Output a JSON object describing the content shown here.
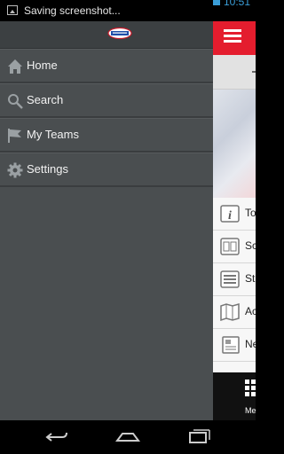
{
  "status_bar": {
    "notification_text": "Saving screenshot...",
    "clock": "10:51"
  },
  "drawer": {
    "items": [
      {
        "label": "Home",
        "icon": "home-icon"
      },
      {
        "label": "Search",
        "icon": "search-icon"
      },
      {
        "label": "My Teams",
        "icon": "flag-icon"
      },
      {
        "label": "Settings",
        "icon": "gear-icon"
      }
    ]
  },
  "content": {
    "rows": [
      {
        "label": "To",
        "icon": "info-icon"
      },
      {
        "label": "Sc",
        "icon": "scoreboard-icon"
      },
      {
        "label": "St",
        "icon": "list-icon"
      },
      {
        "label": "Ac",
        "icon": "map-icon"
      },
      {
        "label": "Ne",
        "icon": "news-icon"
      }
    ],
    "tab_label": "Me"
  },
  "colors": {
    "accent_red": "#e41d2e",
    "drawer_bg": "#4a4e50",
    "status_blue": "#3a9ed8"
  }
}
